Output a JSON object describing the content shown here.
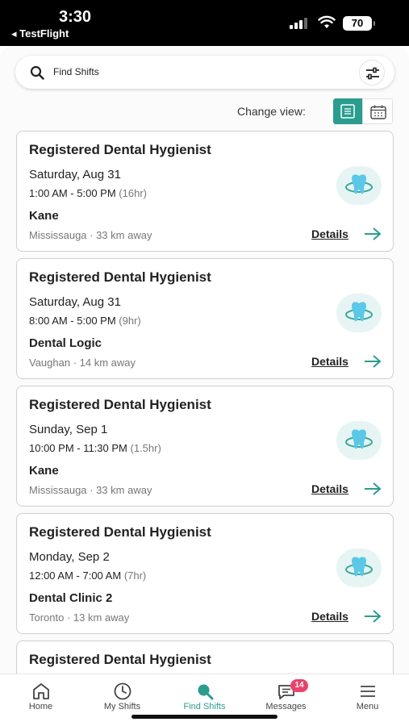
{
  "status_bar": {
    "time": "3:30",
    "back_app": "◂ TestFlight",
    "battery": "70"
  },
  "search": {
    "placeholder": "Find Shifts",
    "icon": "search-icon",
    "filter_icon": "sliders-icon"
  },
  "view_toggle": {
    "label": "Change view:",
    "options": [
      "list-view-icon",
      "calendar-view-icon"
    ],
    "selected": "list"
  },
  "shifts": [
    {
      "title": "Registered Dental Hygienist",
      "date": "Saturday, Aug 31",
      "time": "1:00 AM - 5:00 PM",
      "duration": "(16hr)",
      "clinic": "Kane",
      "location": "Mississauga · 33 km away",
      "details_label": "Details",
      "logo": "tooth-logo-icon"
    },
    {
      "title": "Registered Dental Hygienist",
      "date": "Saturday, Aug 31",
      "time": "8:00 AM - 5:00 PM",
      "duration": "(9hr)",
      "clinic": "Dental Logic",
      "location": "Vaughan · 14 km away",
      "details_label": "Details",
      "logo": "tooth-logo-icon"
    },
    {
      "title": "Registered Dental Hygienist",
      "date": "Sunday, Sep 1",
      "time": "10:00 PM - 11:30 PM",
      "duration": "(1.5hr)",
      "clinic": "Kane",
      "location": "Mississauga · 33 km away",
      "details_label": "Details",
      "logo": "tooth-logo-icon"
    },
    {
      "title": "Registered Dental Hygienist",
      "date": "Monday, Sep 2",
      "time": "12:00 AM - 7:00 AM",
      "duration": "(7hr)",
      "clinic": "Dental Clinic 2",
      "location": "Toronto · 13 km away",
      "details_label": "Details",
      "logo": "tooth-logo-icon"
    },
    {
      "title": "Registered Dental Hygienist"
    }
  ],
  "tabs": [
    {
      "label": "Home",
      "icon": "home-icon"
    },
    {
      "label": "My Shifts",
      "icon": "clock-icon"
    },
    {
      "label": "Find Shifts",
      "icon": "search-icon",
      "active": true
    },
    {
      "label": "Messages",
      "icon": "chat-icon",
      "badge": "14"
    },
    {
      "label": "Menu",
      "icon": "menu-icon"
    }
  ],
  "colors": {
    "accent": "#2a9d8f",
    "badge": "#e8436a",
    "logo_bg": "#e6f5f3"
  }
}
